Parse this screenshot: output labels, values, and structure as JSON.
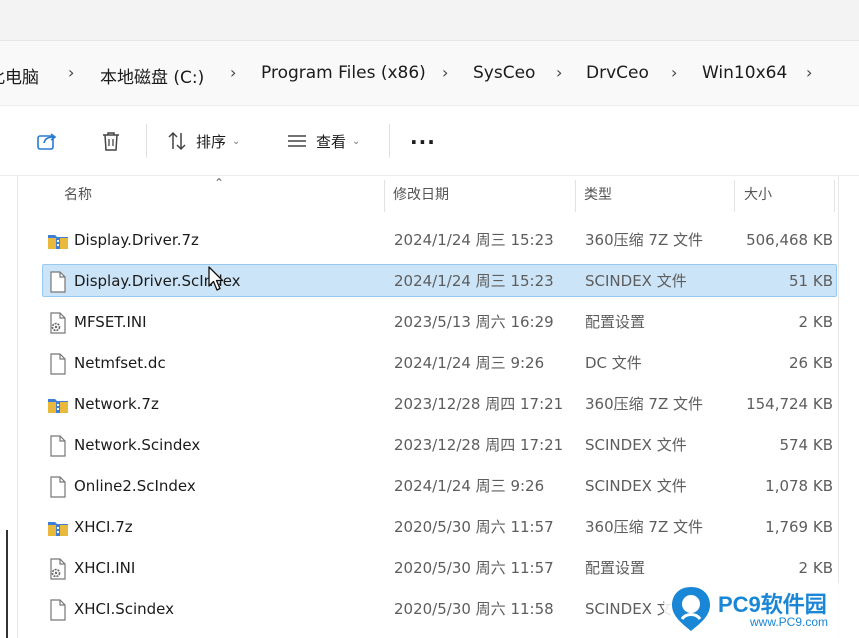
{
  "breadcrumb": {
    "items": [
      "此电脑",
      "本地磁盘 (C:)",
      "Program Files (x86)",
      "SysCeo",
      "DrvCeo",
      "Win10x64"
    ],
    "separator": "›"
  },
  "toolbar": {
    "share_icon": "share-icon",
    "delete_icon": "trash-icon",
    "sort_label": "排序",
    "view_label": "查看",
    "more_label": "..."
  },
  "columns": {
    "name": "名称",
    "modified": "修改日期",
    "type": "类型",
    "size": "大小"
  },
  "files": [
    {
      "name": "Display.Driver.7z",
      "modified": "2024/1/24 周三 15:23",
      "type": "360压缩 7Z 文件",
      "size": "506,468 KB",
      "icon": "archive-icon"
    },
    {
      "name": "Display.Driver.ScIndex",
      "modified": "2024/1/24 周三 15:23",
      "type": "SCINDEX 文件",
      "size": "51 KB",
      "icon": "file-icon"
    },
    {
      "name": "MFSET.INI",
      "modified": "2023/5/13 周六 16:29",
      "type": "配置设置",
      "size": "2 KB",
      "icon": "settings-file-icon"
    },
    {
      "name": "Netmfset.dc",
      "modified": "2024/1/24 周三 9:26",
      "type": "DC 文件",
      "size": "26 KB",
      "icon": "file-icon"
    },
    {
      "name": "Network.7z",
      "modified": "2023/12/28 周四 17:21",
      "type": "360压缩 7Z 文件",
      "size": "154,724 KB",
      "icon": "archive-icon"
    },
    {
      "name": "Network.Scindex",
      "modified": "2023/12/28 周四 17:21",
      "type": "SCINDEX 文件",
      "size": "574 KB",
      "icon": "file-icon"
    },
    {
      "name": "Online2.ScIndex",
      "modified": "2024/1/24 周三 9:26",
      "type": "SCINDEX 文件",
      "size": "1,078 KB",
      "icon": "file-icon"
    },
    {
      "name": "XHCI.7z",
      "modified": "2020/5/30 周六 11:57",
      "type": "360压缩 7Z 文件",
      "size": "1,769 KB",
      "icon": "archive-icon"
    },
    {
      "name": "XHCI.INI",
      "modified": "2020/5/30 周六 11:57",
      "type": "配置设置",
      "size": "2 KB",
      "icon": "settings-file-icon"
    },
    {
      "name": "XHCI.Scindex",
      "modified": "2020/5/30 周六 11:58",
      "type": "SCINDEX 文",
      "size": "",
      "icon": "file-icon"
    }
  ],
  "selected_index": 1,
  "watermark": {
    "text": "PC9软件园",
    "sub": "www.PC9.com"
  },
  "colors": {
    "selection": "#cce4f7",
    "selection_border": "#99c9ef",
    "watermark": "#1a86d6"
  }
}
